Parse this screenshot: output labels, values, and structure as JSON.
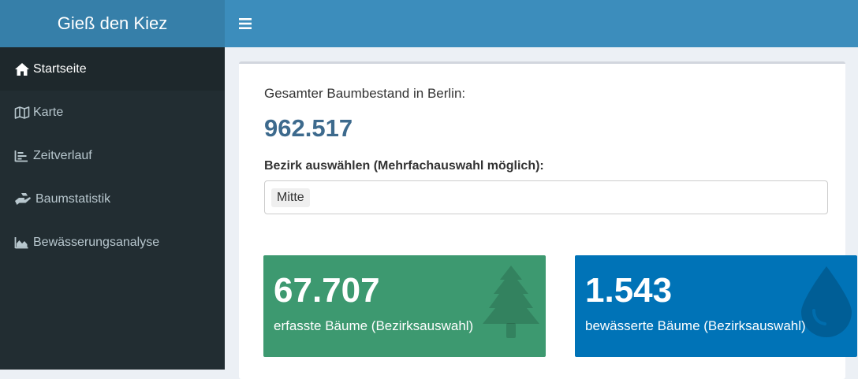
{
  "app": {
    "title": "Gieß den Kiez"
  },
  "topbar": {
    "toggle_icon": "bars-icon"
  },
  "sidebar": {
    "items": [
      {
        "label": "Startseite",
        "icon": "home-icon",
        "active": true
      },
      {
        "label": "Karte",
        "icon": "map-icon",
        "active": false
      },
      {
        "label": "Zeitverlauf",
        "icon": "timeline-icon",
        "active": false
      },
      {
        "label": "Baumstatistik",
        "icon": "hand-holding-icon",
        "active": false
      },
      {
        "label": "Bewässerungsanalyse",
        "icon": "area-chart-icon",
        "active": false
      }
    ]
  },
  "main": {
    "total_label": "Gesamter Baumbestand in Berlin:",
    "total_value": "962.517",
    "select_label": "Bezirk auswählen (Mehrfachauswahl möglich):",
    "selected_chip": "Mitte",
    "boxes": [
      {
        "value": "67.707",
        "caption": "erfasste Bäume (Bezirksauswahl)",
        "icon": "tree-icon",
        "color": "#3d9970"
      },
      {
        "value": "1.543",
        "caption": "bewässerte Bäume (Bezirksauswahl)",
        "icon": "tint-icon",
        "color": "#0073b7"
      }
    ]
  },
  "colors": {
    "logo_bg": "#367fa9",
    "header_bg": "#3c8dbc",
    "sidebar_bg": "#222d32",
    "content_bg": "#ecf0f5",
    "total_value": "#3d6a8d"
  }
}
